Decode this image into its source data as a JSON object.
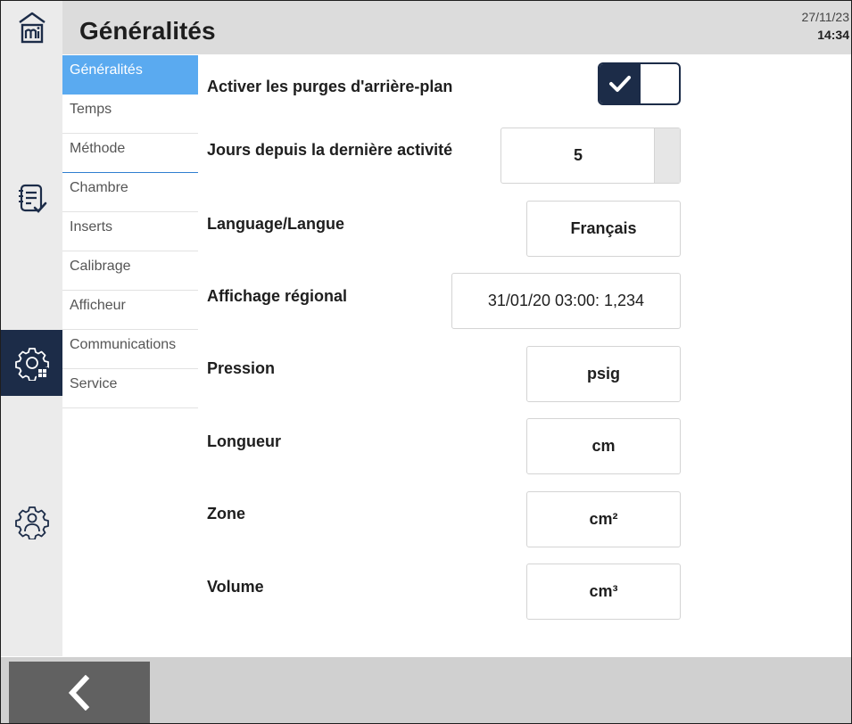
{
  "header": {
    "title": "Généralités",
    "date": "27/11/23",
    "time": "14:34"
  },
  "rail": [
    {
      "icon": "home-mi-icon"
    },
    {
      "icon": "checklist-icon"
    },
    {
      "icon": "system-settings-icon",
      "active": true
    },
    {
      "icon": "user-settings-icon"
    }
  ],
  "submenu": {
    "items": [
      {
        "label": "Généralités",
        "active": true
      },
      {
        "label": "Temps"
      },
      {
        "label": "Méthode"
      },
      {
        "label": "Chambre"
      },
      {
        "label": "Inserts"
      },
      {
        "label": "Calibrage"
      },
      {
        "label": "Afficheur"
      },
      {
        "label": "Communications"
      },
      {
        "label": "Service"
      }
    ]
  },
  "settings": {
    "background_purge": {
      "label": "Activer les purges d'arrière-plan",
      "checked": true
    },
    "days_since_activity": {
      "label": "Jours depuis la dernière activité",
      "value": "5"
    },
    "language": {
      "label": "Language/Langue",
      "value": "Français"
    },
    "regional_display": {
      "label": "Affichage régional",
      "value": "31/01/20 03:00: 1,234"
    },
    "pressure": {
      "label": "Pression",
      "value": "psig"
    },
    "length": {
      "label": "Longueur",
      "value": "cm"
    },
    "area": {
      "label": "Zone",
      "value": "cm²"
    },
    "volume": {
      "label": "Volume",
      "value": "cm³"
    }
  },
  "footer": {
    "back_icon": "chevron-left-icon"
  },
  "colors": {
    "accent": "#5aaaf0",
    "dark": "#1c2c48",
    "header_bg": "#dcdcdc",
    "rail_bg": "#ebebeb",
    "footer_bg": "#d0d0d0",
    "back_bg": "#616161"
  }
}
